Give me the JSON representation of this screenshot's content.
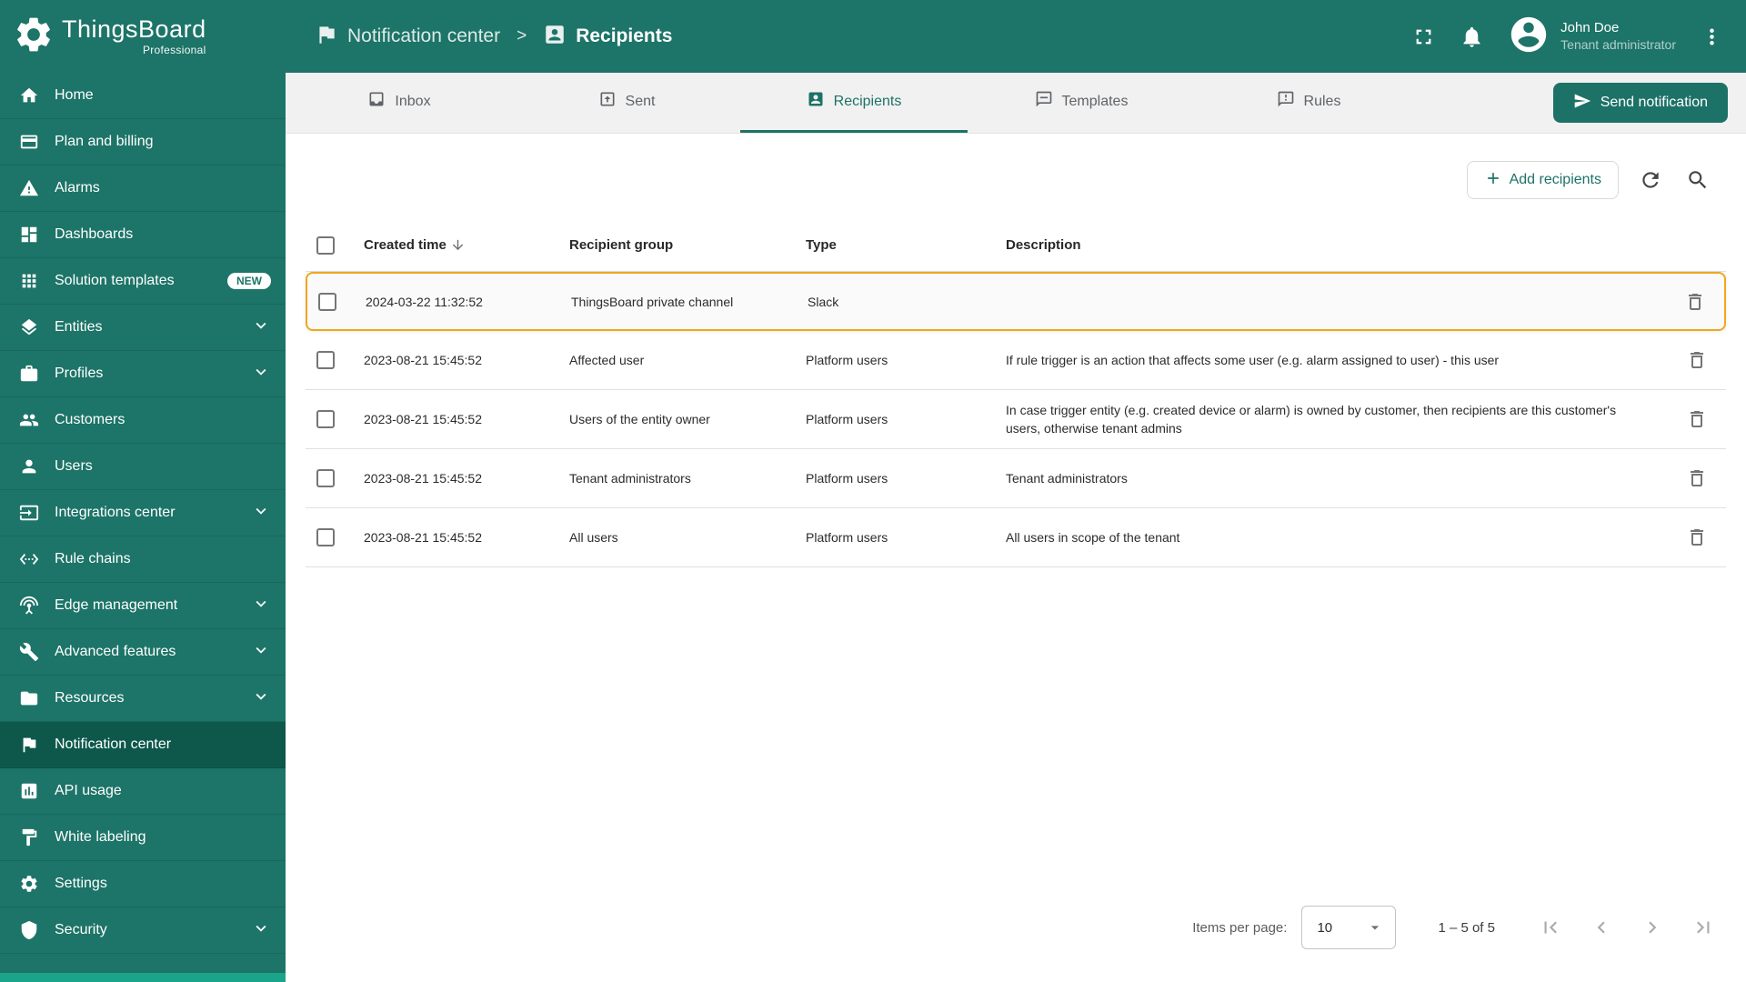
{
  "brand": {
    "name": "ThingsBoard",
    "edition": "Professional"
  },
  "header": {
    "breadcrumb": [
      {
        "label": "Notification center"
      },
      {
        "label": "Recipients"
      }
    ],
    "separator": ">",
    "user": {
      "name": "John Doe",
      "role": "Tenant administrator"
    }
  },
  "sidebar": {
    "items": [
      {
        "label": "Home"
      },
      {
        "label": "Plan and billing"
      },
      {
        "label": "Alarms"
      },
      {
        "label": "Dashboards"
      },
      {
        "label": "Solution templates",
        "badge": "NEW"
      },
      {
        "label": "Entities"
      },
      {
        "label": "Profiles"
      },
      {
        "label": "Customers"
      },
      {
        "label": "Users"
      },
      {
        "label": "Integrations center"
      },
      {
        "label": "Rule chains"
      },
      {
        "label": "Edge management"
      },
      {
        "label": "Advanced features"
      },
      {
        "label": "Resources"
      },
      {
        "label": "Notification center"
      },
      {
        "label": "API usage"
      },
      {
        "label": "White labeling"
      },
      {
        "label": "Settings"
      },
      {
        "label": "Security"
      }
    ]
  },
  "tabs": [
    {
      "label": "Inbox"
    },
    {
      "label": "Sent"
    },
    {
      "label": "Recipients"
    },
    {
      "label": "Templates"
    },
    {
      "label": "Rules"
    }
  ],
  "toolbar": {
    "send_notification": "Send notification",
    "add_recipients": "Add recipients"
  },
  "table": {
    "columns": [
      "Created time",
      "Recipient group",
      "Type",
      "Description"
    ],
    "rows": [
      {
        "created_time": "2024-03-22 11:32:52",
        "recipient_group": "ThingsBoard private channel",
        "type": "Slack",
        "description": ""
      },
      {
        "created_time": "2023-08-21 15:45:52",
        "recipient_group": "Affected user",
        "type": "Platform users",
        "description": "If rule trigger is an action that affects some user (e.g. alarm assigned to user) - this user"
      },
      {
        "created_time": "2023-08-21 15:45:52",
        "recipient_group": "Users of the entity owner",
        "type": "Platform users",
        "description": "In case trigger entity (e.g. created device or alarm) is owned by customer, then recipients are this customer's users, otherwise tenant admins"
      },
      {
        "created_time": "2023-08-21 15:45:52",
        "recipient_group": "Tenant administrators",
        "type": "Platform users",
        "description": "Tenant administrators"
      },
      {
        "created_time": "2023-08-21 15:45:52",
        "recipient_group": "All users",
        "type": "Platform users",
        "description": "All users in scope of the tenant"
      }
    ]
  },
  "pagination": {
    "items_per_page_label": "Items per page:",
    "items_per_page_value": "10",
    "range_label": "1 – 5 of 5"
  },
  "colors": {
    "primary": "#1d7268",
    "sidebar_active": "#0d584b",
    "highlight_border": "#f0a71f",
    "badge_bg": "#ffffff"
  }
}
